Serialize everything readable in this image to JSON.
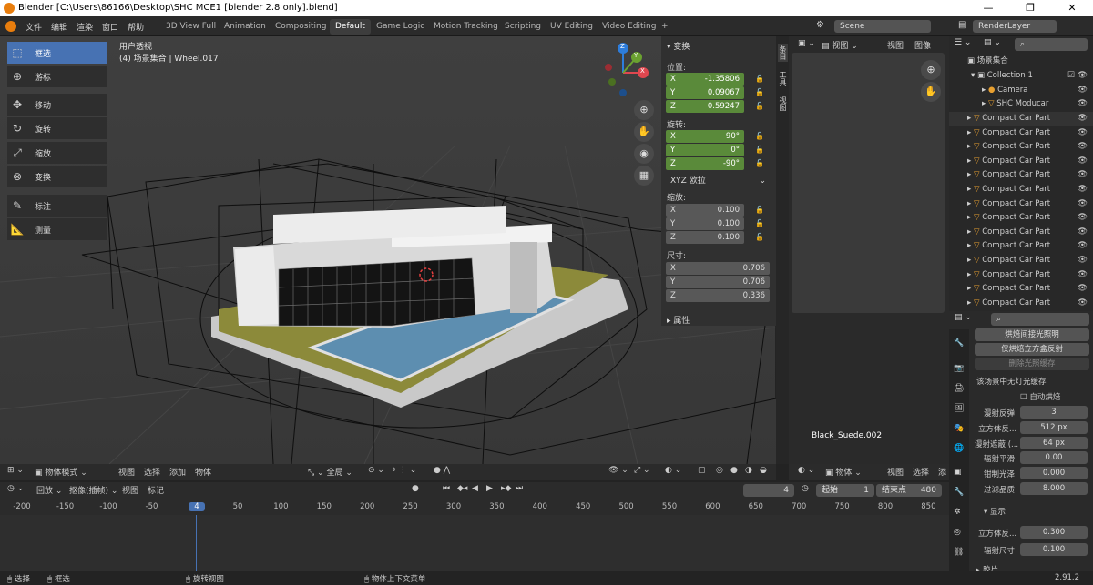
{
  "window": {
    "title": "Blender [C:\\Users\\86166\\Desktop\\SHC MCE1 [blender 2.8 only].blend]",
    "minimize": "—",
    "maximize": "❐",
    "close": "✕"
  },
  "menu": [
    "文件",
    "编辑",
    "渲染",
    "窗口",
    "帮助"
  ],
  "workspaces": [
    "3D View Full",
    "Animation",
    "Compositing",
    "Default",
    "Game Logic",
    "Motion Tracking",
    "Scripting",
    "UV Editing",
    "Video Editing",
    "+"
  ],
  "scene": {
    "label": "Scene",
    "view_layer": "RenderLayer"
  },
  "viewport": {
    "view_name": "用户透视",
    "object_info": "(4) 场景集合 | Wheel.017",
    "tools": [
      "框选",
      "游标",
      "移动",
      "旋转",
      "缩放",
      "变换",
      "标注",
      "测量"
    ],
    "axis": {
      "z": "Z",
      "y": "Y",
      "x": "X"
    },
    "material_label": "Black_Suede.002",
    "header_bottom": [
      "物体模式",
      "视图",
      "选择",
      "添加",
      "物体",
      "全局"
    ]
  },
  "npanel": {
    "title": "变换",
    "location_label": "位置:",
    "location": [
      {
        "axis": "X",
        "value": "-1.35806"
      },
      {
        "axis": "Y",
        "value": "0.09067"
      },
      {
        "axis": "Z",
        "value": "0.59247"
      }
    ],
    "rotation_label": "旋转:",
    "rotation": [
      {
        "axis": "X",
        "value": "90°"
      },
      {
        "axis": "Y",
        "value": "0°"
      },
      {
        "axis": "Z",
        "value": "-90°"
      }
    ],
    "rotation_mode": "XYZ 欧拉",
    "scale_label": "缩放:",
    "scale": [
      {
        "axis": "X",
        "value": "0.100"
      },
      {
        "axis": "Y",
        "value": "0.100"
      },
      {
        "axis": "Z",
        "value": "0.100"
      }
    ],
    "dimensions_label": "尺寸:",
    "dimensions": [
      {
        "axis": "X",
        "value": "0.706"
      },
      {
        "axis": "Y",
        "value": "0.706"
      },
      {
        "axis": "Z",
        "value": "0.336"
      }
    ],
    "properties_label": "属性",
    "side_tabs": [
      "条目",
      "工具",
      "视图"
    ]
  },
  "image_editor": {
    "view": "视图",
    "view2": "视图",
    "image": "图像",
    "bottom": [
      "物体",
      "视图",
      "选择",
      "添"
    ]
  },
  "outliner": {
    "root": "场景集合",
    "collection": "Collection 1",
    "items": [
      "Camera",
      "SHC Moducar",
      "Compact Car Part",
      "Compact Car Part",
      "Compact Car Part",
      "Compact Car Part",
      "Compact Car Part",
      "Compact Car Part",
      "Compact Car Part",
      "Compact Car Part",
      "Compact Car Part",
      "Compact Car Part",
      "Compact Car Part",
      "Compact Car Part",
      "Compact Car Part",
      "Compact Car Part"
    ]
  },
  "properties": {
    "bake_indirect": "烘焙间接光照明",
    "bake_cubemap": "仅烘焙立方盒反射",
    "delete_cache": "删除光照缓存",
    "no_cache_text": "该场景中无灯光缓存",
    "auto_bake": "自动烘焙",
    "diffuse_bounces_label": "漫射反弹",
    "diffuse_bounces": "3",
    "cubemap_size_label": "立方体反...",
    "cubemap_size": "512 px",
    "diffuse_occlusion_label": "漫射遮蔽 (...",
    "diffuse_occlusion": "64 px",
    "irradiance_smoothing_label": "辐射平滑",
    "irradiance_smoothing": "0.00",
    "clamp_glossy_label": "钳制光泽",
    "clamp_glossy": "0.000",
    "filter_quality_label": "过滤品质",
    "filter_quality": "8.000",
    "display_label": "显示",
    "cubemap_display_label": "立方体反...",
    "cubemap_display": "0.300",
    "irradiance_size_label": "辐射尺寸",
    "irradiance_size": "0.100",
    "next_section": "胶片"
  },
  "timeline": {
    "playback": "回放",
    "keying": "抠像(插帧)",
    "view": "视图",
    "marker": "标记",
    "current_frame": "4",
    "start_label": "起始",
    "start": "1",
    "end_label": "结束点",
    "end": "480",
    "ticks": [
      "-200",
      "-150",
      "-100",
      "-50",
      "4",
      "50",
      "100",
      "150",
      "200",
      "250",
      "300",
      "350",
      "400",
      "450",
      "500",
      "550",
      "600",
      "650",
      "700",
      "750",
      "800",
      "850"
    ]
  },
  "status": {
    "select": "选择",
    "box_select": "框选",
    "rotate_view": "旋转视图",
    "context_menu": "物体上下文菜单",
    "version": "2.91.2"
  },
  "colors": {
    "accent": "#4772b3",
    "active_field": "#5a8a3a",
    "axis_x": "#e0474f",
    "axis_y": "#6ba230",
    "axis_z": "#2d7ddc"
  }
}
